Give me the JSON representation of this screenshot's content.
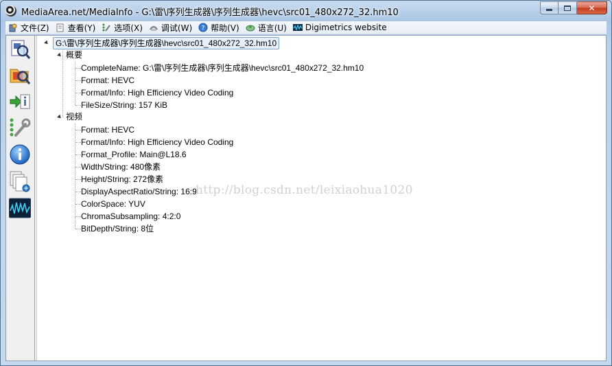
{
  "window": {
    "title": "MediaArea.net/MediaInfo - G:\\雷\\序列生成器\\序列生成器\\hevc\\src01_480x272_32.hm10",
    "close_glyph": "✕"
  },
  "menu": [
    {
      "label": "文件(Z)",
      "icon": "file-icon"
    },
    {
      "label": "查看(Y)",
      "icon": "view-icon"
    },
    {
      "label": "选项(X)",
      "icon": "options-icon"
    },
    {
      "label": "调试(W)",
      "icon": "debug-icon"
    },
    {
      "label": "帮助(V)",
      "icon": "help-icon"
    },
    {
      "label": "语言(U)",
      "icon": "language-icon"
    },
    {
      "label": "Digimetrics website",
      "icon": "digimetrics-icon"
    }
  ],
  "toolbar": [
    {
      "icon": "open-file-icon"
    },
    {
      "icon": "open-folder-icon"
    },
    {
      "icon": "export-icon"
    },
    {
      "icon": "preferences-icon"
    },
    {
      "icon": "about-icon"
    },
    {
      "icon": "sheet-view-icon"
    },
    {
      "icon": "digimetrics-logo-icon"
    }
  ],
  "tree": {
    "root": "G:\\雷\\序列生成器\\序列生成器\\hevc\\src01_480x272_32.hm10",
    "general": {
      "label": "概要",
      "items": [
        "CompleteName: G:\\雷\\序列生成器\\序列生成器\\hevc\\src01_480x272_32.hm10",
        "Format: HEVC",
        "Format/Info: High Efficiency Video Coding",
        "FileSize/String: 157 KiB"
      ]
    },
    "video": {
      "label": "视频",
      "items": [
        "Format: HEVC",
        "Format/Info: High Efficiency Video Coding",
        "Format_Profile: Main@L18.6",
        "Width/String: 480像素",
        "Height/String: 272像素",
        "DisplayAspectRatio/String: 16:9",
        "ColorSpace: YUV",
        "ChromaSubsampling: 4:2:0",
        "BitDepth/String: 8位"
      ]
    }
  },
  "watermark": "http://blog.csdn.net/leixiaohua1020",
  "colors": {
    "selection_border": "#7da2ce",
    "selection_fill": "#e5f0fb",
    "close_button": "#c4391d"
  }
}
